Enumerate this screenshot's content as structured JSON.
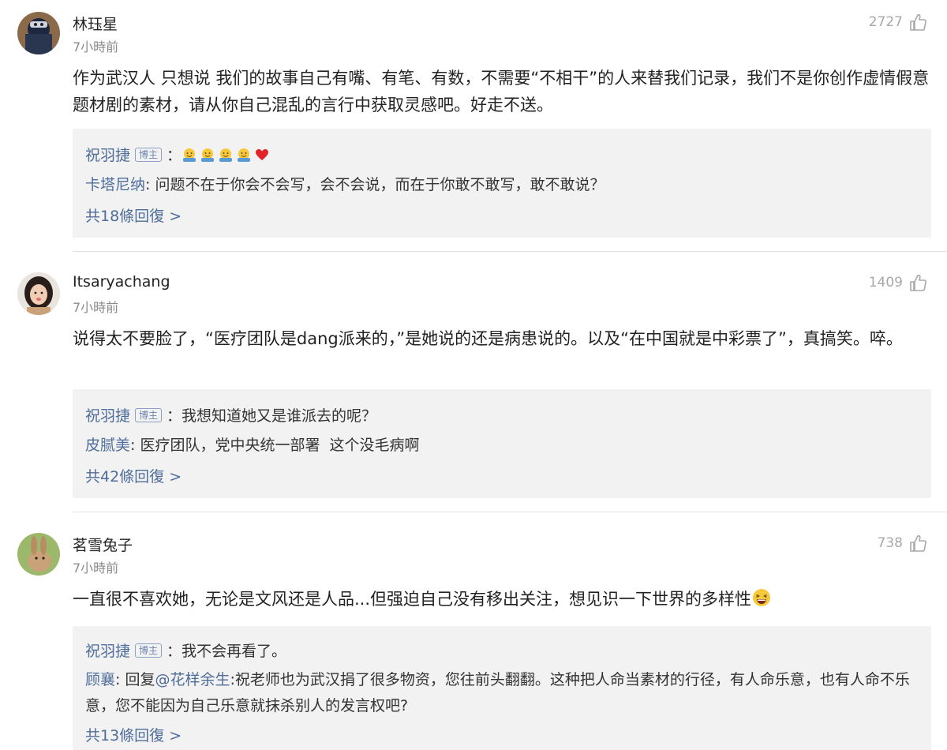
{
  "comments": [
    {
      "username": "林珏星",
      "time": "7小時前",
      "likes": "2727",
      "text": "作为武汉人 只想说 我们的故事自己有嘴、有笔、有数，不需要“不相干”的人来替我们记录，我们不是你创作虚情假意题材剧的素材，请从你自己混乱的言行中获取灵感吧。好走不送。",
      "replies": [
        {
          "name": "祝羽捷",
          "badge": "博主",
          "sep": "：",
          "text": "",
          "emoji": [
            "hug-emoji",
            "hug-emoji",
            "hug-emoji",
            "hug-emoji",
            "heart-emoji"
          ]
        },
        {
          "name": "卡塔尼纳",
          "sep": ": ",
          "text": "问题不在于你会不会写，会不会说，而在于你敢不敢写，敢不敢说？"
        }
      ],
      "more": "共18條回復 >"
    },
    {
      "username": "Itsaryachang",
      "time": "7小時前",
      "likes": "1409",
      "text": "说得太不要脸了，“医疗团队是dang派来的，”是她说的还是病患说的。以及“在中国就是中彩票了”，真搞笑。啐。",
      "replies": [
        {
          "name": "祝羽捷",
          "badge": "博主",
          "sep": "：",
          "text": "我想知道她又是谁派去的呢？"
        },
        {
          "name": "皮腻美",
          "sep": ": ",
          "text": "医疗团队，党中央统一部署  这个没毛病啊"
        }
      ],
      "more": "共42條回復 >"
    },
    {
      "username": "茗雪兔子",
      "time": "7小時前",
      "likes": "738",
      "text": "一直很不喜欢她，无论是文风还是人品...但强迫自己没有移出关注，想见识一下世界的多样性",
      "text_emoji": "laughing-emoji",
      "replies": [
        {
          "name": "祝羽捷",
          "badge": "博主",
          "sep": "：",
          "text": "我不会再看了。"
        },
        {
          "name": "顾襄",
          "sep": ": ",
          "prefix": "回复",
          "mention": "@花样余生",
          "text": ":祝老师也为武汉捐了很多物资，您往前头翻翻。这种把人命当素材的行径，有人命乐意，也有人命不乐意，您不能因为自己乐意就抹杀别人的发言权吧?"
        }
      ],
      "more": "共13條回復 >"
    }
  ],
  "colors": {
    "link": "#4f6d9a",
    "reply_bg": "#f2f2f2",
    "meta": "#8a8a8a"
  }
}
